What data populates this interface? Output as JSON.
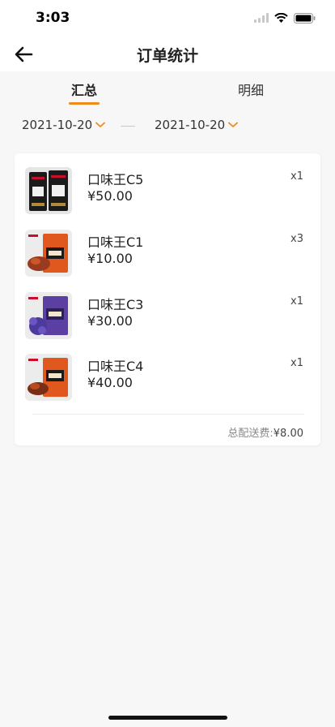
{
  "status_bar": {
    "time": "3:03"
  },
  "header": {
    "title": "订单统计"
  },
  "tabs": [
    {
      "label": "汇总",
      "active": true
    },
    {
      "label": "明细",
      "active": false
    }
  ],
  "date_range": {
    "start": "2021-10-20",
    "end": "2021-10-20",
    "separator": "—"
  },
  "items": [
    {
      "name": "口味王C5",
      "price": "¥50.00",
      "qty": "x1",
      "package_color": "#1b1b1b"
    },
    {
      "name": "口味王C1",
      "price": "¥10.00",
      "qty": "x3",
      "package_color": "#e0581e"
    },
    {
      "name": "口味王C3",
      "price": "¥30.00",
      "qty": "x1",
      "package_color": "#5b3fa3"
    },
    {
      "name": "口味王C4",
      "price": "¥40.00",
      "qty": "x1",
      "package_color": "#e0581e"
    }
  ],
  "summary": {
    "fee_label": "总配送费:",
    "fee_value": "¥8.00"
  },
  "colors": {
    "accent": "#f08a1c",
    "background": "#f7f7f7",
    "card": "#ffffff"
  }
}
